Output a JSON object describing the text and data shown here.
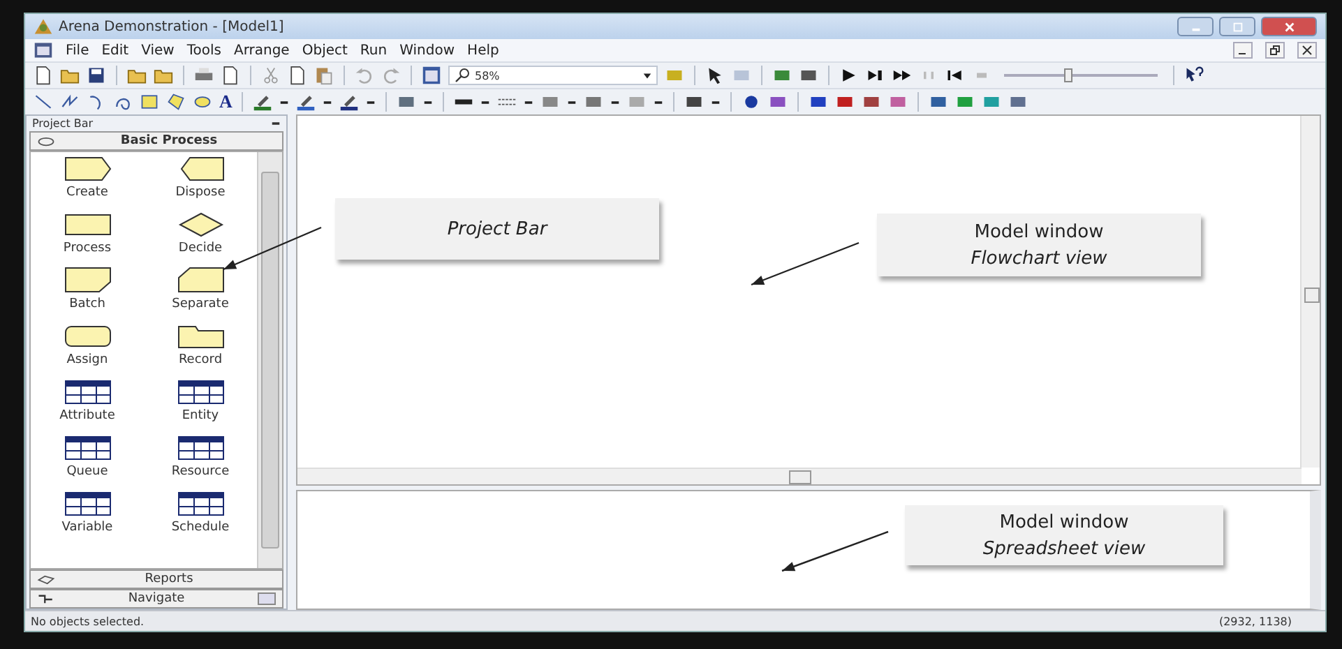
{
  "window": {
    "title": "Arena Demonstration - [Model1]"
  },
  "menu": [
    {
      "label": "File"
    },
    {
      "label": "Edit"
    },
    {
      "label": "View"
    },
    {
      "label": "Tools"
    },
    {
      "label": "Arrange"
    },
    {
      "label": "Object"
    },
    {
      "label": "Run"
    },
    {
      "label": "Window"
    },
    {
      "label": "Help"
    }
  ],
  "toolbar": {
    "zoom": "58%",
    "text_tool": "A",
    "speed_slider": {
      "level": 0.42
    }
  },
  "project_bar": {
    "title": "Project Bar",
    "panel": "Basic Process",
    "modules": [
      {
        "label": "Create",
        "kind": "create"
      },
      {
        "label": "Dispose",
        "kind": "dispose"
      },
      {
        "label": "Process",
        "kind": "process"
      },
      {
        "label": "Decide",
        "kind": "decide"
      },
      {
        "label": "Batch",
        "kind": "batch"
      },
      {
        "label": "Separate",
        "kind": "separate"
      },
      {
        "label": "Assign",
        "kind": "assign"
      },
      {
        "label": "Record",
        "kind": "record"
      },
      {
        "label": "Attribute",
        "kind": "data"
      },
      {
        "label": "Entity",
        "kind": "data"
      },
      {
        "label": "Queue",
        "kind": "data"
      },
      {
        "label": "Resource",
        "kind": "data"
      },
      {
        "label": "Variable",
        "kind": "data"
      },
      {
        "label": "Schedule",
        "kind": "data"
      }
    ],
    "panels": [
      {
        "label": "Reports",
        "kind": "reports"
      },
      {
        "label": "Navigate",
        "kind": "navigate"
      }
    ]
  },
  "callouts": [
    {
      "lines": [
        {
          "text": "Project Bar",
          "italic": true
        }
      ]
    },
    {
      "lines": [
        {
          "text": "Model window",
          "italic": false
        },
        {
          "text": "Flowchart view",
          "italic": true
        }
      ]
    },
    {
      "lines": [
        {
          "text": "Model window",
          "italic": false
        },
        {
          "text": "Spreadsheet view",
          "italic": true
        }
      ]
    }
  ],
  "status_bar": {
    "message": "No objects selected.",
    "coordinates": "(2932, 1138)"
  }
}
